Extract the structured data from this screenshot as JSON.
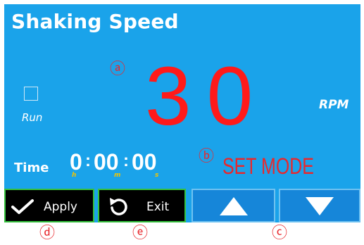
{
  "screen": {
    "title": "Shaking Speed",
    "run_label": "Run",
    "speed_value": "30",
    "speed_unit": "RPM",
    "mode_text": "SET MODE",
    "time": {
      "label": "Time",
      "hours": "0",
      "minutes": "00",
      "seconds": "00",
      "hours_unit": "h",
      "minutes_unit": "m",
      "seconds_unit": "s"
    },
    "markers": {
      "a": "ⓐ",
      "b": "ⓑ"
    }
  },
  "buttons": {
    "apply": {
      "label": "Apply",
      "icon": "check-icon"
    },
    "exit": {
      "label": "Exit",
      "icon": "undo-arrow-icon"
    },
    "up": {
      "icon": "triangle-up-icon"
    },
    "down": {
      "icon": "triangle-down-icon"
    }
  },
  "callouts": {
    "d": "ⓓ",
    "e": "ⓔ",
    "c": "ⓒ"
  },
  "colors": {
    "screen_bg": "#1aa3ea",
    "speed_red": "#ff1a1a",
    "marker_red": "#e8282d",
    "button_dark": "#000000",
    "button_blue": "#1686d9",
    "button_green_border": "#36c23e",
    "time_unit_yellow": "#f2c400"
  }
}
